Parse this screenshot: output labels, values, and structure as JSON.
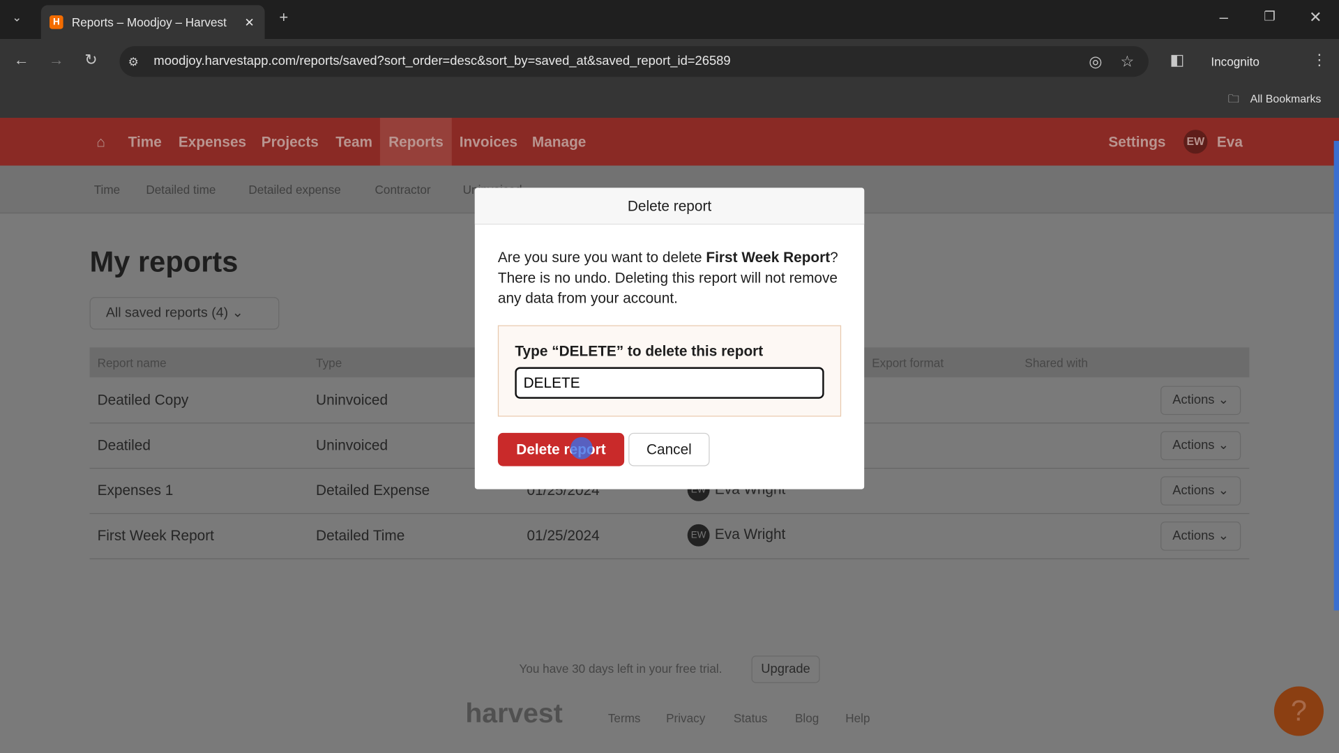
{
  "browser": {
    "tab_title": "Reports – Moodjoy – Harvest",
    "url": "moodjoy.harvestapp.com/reports/saved?sort_order=desc&sort_by=saved_at&saved_report_id=26589",
    "incognito": "Incognito",
    "bookmarks": "All Bookmarks"
  },
  "nav": {
    "items": [
      "Time",
      "Expenses",
      "Projects",
      "Team",
      "Reports",
      "Invoices",
      "Manage"
    ],
    "active": "Reports",
    "settings": "Settings",
    "user_initials": "EW",
    "user_name": "Eva"
  },
  "subnav": [
    "Time",
    "Detailed time",
    "Detailed expense",
    "Contractor",
    "Uninvoiced"
  ],
  "page": {
    "title": "My reports",
    "filter": "All saved reports (4)"
  },
  "table": {
    "headers": {
      "name": "Report name",
      "type": "Type",
      "export": "Export format",
      "shared": "Shared with"
    },
    "rows": [
      {
        "name": "Deatiled Copy",
        "type": "Uninvoiced",
        "date": "",
        "creator": "",
        "actions": "Actions"
      },
      {
        "name": "Deatiled",
        "type": "Uninvoiced",
        "date": "",
        "creator": "",
        "actions": "Actions"
      },
      {
        "name": "Expenses 1",
        "type": "Detailed Expense",
        "date": "01/25/2024",
        "creator": "Eva Wright",
        "initials": "EW",
        "actions": "Actions"
      },
      {
        "name": "First Week Report",
        "type": "Detailed Time",
        "date": "01/25/2024",
        "creator": "Eva Wright",
        "initials": "EW",
        "actions": "Actions"
      }
    ]
  },
  "modal": {
    "title": "Delete report",
    "text_pre": "Are you sure you want to delete ",
    "report_name": "First Week Report",
    "text_post": "? There is no undo. Deleting this report will not remove any data from your account.",
    "confirm_label": "Type “DELETE” to delete this report",
    "confirm_value": "DELETE",
    "delete_button": "Delete report",
    "cancel_button": "Cancel"
  },
  "footer": {
    "trial": "You have 30 days left in your free trial.",
    "upgrade": "Upgrade",
    "logo": "harvest",
    "links": [
      "Terms",
      "Privacy",
      "Status",
      "Blog",
      "Help"
    ]
  },
  "colors": {
    "nav": "#8a2a25",
    "delete": "#c92a2a"
  }
}
